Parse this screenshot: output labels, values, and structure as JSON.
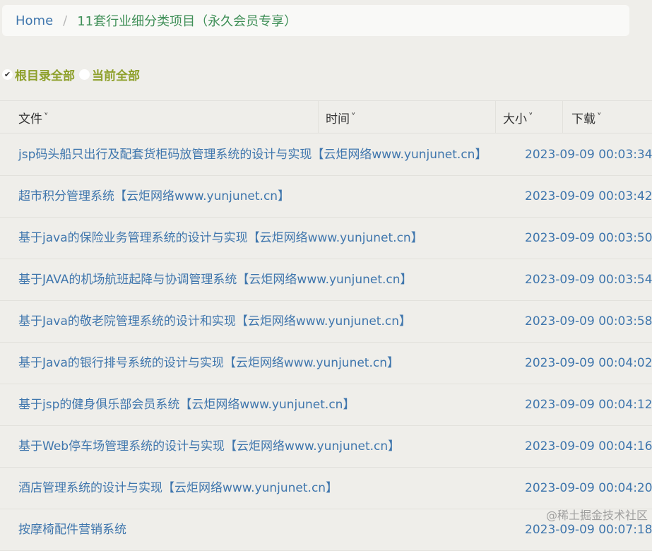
{
  "breadcrumb": {
    "home": "Home",
    "separator": "/",
    "current": "11套行业细分类项目（永久会员专享）"
  },
  "filters": {
    "root_all": "根目录全部",
    "current_all": "当前全部",
    "check_mark": "✔"
  },
  "table": {
    "headers": {
      "file": "文件",
      "time": "时间",
      "size": "大小",
      "download": "下载"
    },
    "chevron": "❯",
    "rows": [
      {
        "name": "jsp码头船只出行及配套货柜码放管理系统的设计与实现【云炬网络www.yunjunet.cn】",
        "time": "2023-09-09 00:03:34"
      },
      {
        "name": "超市积分管理系统【云炬网络www.yunjunet.cn】",
        "time": "2023-09-09 00:03:42"
      },
      {
        "name": "基于java的保险业务管理系统的设计与实现【云炬网络www.yunjunet.cn】",
        "time": "2023-09-09 00:03:50"
      },
      {
        "name": "基于JAVA的机场航班起降与协调管理系统【云炬网络www.yunjunet.cn】",
        "time": "2023-09-09 00:03:54"
      },
      {
        "name": "基于Java的敬老院管理系统的设计和实现【云炬网络www.yunjunet.cn】",
        "time": "2023-09-09 00:03:58"
      },
      {
        "name": "基于Java的银行排号系统的设计与实现【云炬网络www.yunjunet.cn】",
        "time": "2023-09-09 00:04:02"
      },
      {
        "name": "基于jsp的健身俱乐部会员系统【云炬网络www.yunjunet.cn】",
        "time": "2023-09-09 00:04:12"
      },
      {
        "name": "基于Web停车场管理系统的设计与实现【云炬网络www.yunjunet.cn】",
        "time": "2023-09-09 00:04:16"
      },
      {
        "name": "酒店管理系统的设计与实现【云炬网络www.yunjunet.cn】",
        "time": "2023-09-09 00:04:20"
      },
      {
        "name": "按摩椅配件营销系统",
        "time": "2023-09-09 00:07:18"
      }
    ]
  },
  "watermark": "@稀土掘金技术社区"
}
